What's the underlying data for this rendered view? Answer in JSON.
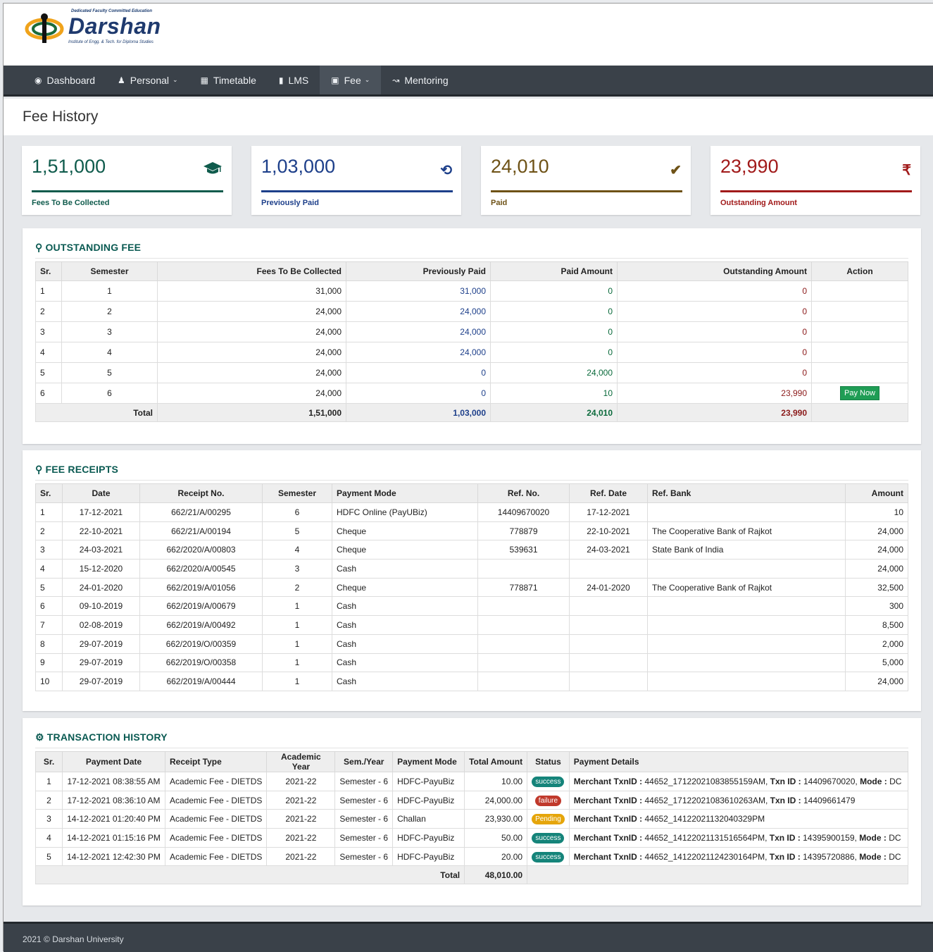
{
  "brand": {
    "tagline": "Dedicated Faculty Committed Education",
    "name": "Darshan",
    "subtitle": "Institute of Engg. & Tech. for Diploma Studies"
  },
  "nav": [
    {
      "label": "Dashboard",
      "icon": "dashboard-icon",
      "dropdown": false
    },
    {
      "label": "Personal",
      "icon": "user-icon",
      "dropdown": true
    },
    {
      "label": "Timetable",
      "icon": "calendar-icon",
      "dropdown": false
    },
    {
      "label": "LMS",
      "icon": "book-icon",
      "dropdown": false
    },
    {
      "label": "Fee",
      "icon": "money-icon",
      "dropdown": true,
      "active": true
    },
    {
      "label": "Mentoring",
      "icon": "chart-line-icon",
      "dropdown": false
    }
  ],
  "page_title": "Fee History",
  "stats": [
    {
      "value": "1,51,000",
      "label": "Fees To Be Collected",
      "icon": "graduation-cap-icon",
      "color": "#0f5b4c"
    },
    {
      "value": "1,03,000",
      "label": "Previously Paid",
      "icon": "history-icon",
      "color": "#1d3f8a"
    },
    {
      "value": "24,010",
      "label": "Paid",
      "icon": "check-icon",
      "color": "#6e5216"
    },
    {
      "value": "23,990",
      "label": "Outstanding Amount",
      "icon": "rupee-icon",
      "color": "#a11a1a"
    }
  ],
  "outstanding": {
    "title": "OUTSTANDING FEE",
    "headers": [
      "Sr.",
      "Semester",
      "Fees To Be Collected",
      "Previously Paid",
      "Paid Amount",
      "Outstanding Amount",
      "Action"
    ],
    "rows": [
      {
        "sr": "1",
        "sem": "1",
        "fees": "31,000",
        "prev": "31,000",
        "paid": "0",
        "out": "0",
        "action": ""
      },
      {
        "sr": "2",
        "sem": "2",
        "fees": "24,000",
        "prev": "24,000",
        "paid": "0",
        "out": "0",
        "action": ""
      },
      {
        "sr": "3",
        "sem": "3",
        "fees": "24,000",
        "prev": "24,000",
        "paid": "0",
        "out": "0",
        "action": ""
      },
      {
        "sr": "4",
        "sem": "4",
        "fees": "24,000",
        "prev": "24,000",
        "paid": "0",
        "out": "0",
        "action": ""
      },
      {
        "sr": "5",
        "sem": "5",
        "fees": "24,000",
        "prev": "0",
        "paid": "24,000",
        "out": "0",
        "action": ""
      },
      {
        "sr": "6",
        "sem": "6",
        "fees": "24,000",
        "prev": "0",
        "paid": "10",
        "out": "23,990",
        "action": "Pay Now"
      }
    ],
    "total": {
      "label": "Total",
      "fees": "1,51,000",
      "prev": "1,03,000",
      "paid": "24,010",
      "out": "23,990"
    }
  },
  "receipts": {
    "title": "FEE RECEIPTS",
    "headers": [
      "Sr.",
      "Date",
      "Receipt No.",
      "Semester",
      "Payment Mode",
      "Ref. No.",
      "Ref. Date",
      "Ref. Bank",
      "Amount"
    ],
    "rows": [
      [
        "1",
        "17-12-2021",
        "662/21/A/00295",
        "6",
        "HDFC Online (PayUBiz)",
        "14409670020",
        "17-12-2021",
        "",
        "10"
      ],
      [
        "2",
        "22-10-2021",
        "662/21/A/00194",
        "5",
        "Cheque",
        "778879",
        "22-10-2021",
        "The Cooperative Bank of Rajkot",
        "24,000"
      ],
      [
        "3",
        "24-03-2021",
        "662/2020/A/00803",
        "4",
        "Cheque",
        "539631",
        "24-03-2021",
        "State Bank of India",
        "24,000"
      ],
      [
        "4",
        "15-12-2020",
        "662/2020/A/00545",
        "3",
        "Cash",
        "",
        "",
        "",
        "24,000"
      ],
      [
        "5",
        "24-01-2020",
        "662/2019/A/01056",
        "2",
        "Cheque",
        "778871",
        "24-01-2020",
        "The Cooperative Bank of Rajkot",
        "32,500"
      ],
      [
        "6",
        "09-10-2019",
        "662/2019/A/00679",
        "1",
        "Cash",
        "",
        "",
        "",
        "300"
      ],
      [
        "7",
        "02-08-2019",
        "662/2019/A/00492",
        "1",
        "Cash",
        "",
        "",
        "",
        "8,500"
      ],
      [
        "8",
        "29-07-2019",
        "662/2019/O/00359",
        "1",
        "Cash",
        "",
        "",
        "",
        "2,000"
      ],
      [
        "9",
        "29-07-2019",
        "662/2019/O/00358",
        "1",
        "Cash",
        "",
        "",
        "",
        "5,000"
      ],
      [
        "10",
        "29-07-2019",
        "662/2019/A/00444",
        "1",
        "Cash",
        "",
        "",
        "",
        "24,000"
      ]
    ]
  },
  "transactions": {
    "title": "TRANSACTION HISTORY",
    "headers": [
      "Sr.",
      "Payment Date",
      "Receipt Type",
      "Academic Year",
      "Sem./Year",
      "Payment Mode",
      "Total Amount",
      "Status",
      "Payment Details"
    ],
    "rows": [
      {
        "sr": "1",
        "date": "17-12-2021 08:38:55 AM",
        "type": "Academic Fee - DIETDS",
        "ay": "2021-22",
        "sem": "Semester - 6",
        "mode": "HDFC-PayuBiz",
        "amount": "10.00",
        "status": "success",
        "merchant": "44652_17122021083855159AM",
        "txn": "14409670020",
        "pmode": "DC"
      },
      {
        "sr": "2",
        "date": "17-12-2021 08:36:10 AM",
        "type": "Academic Fee - DIETDS",
        "ay": "2021-22",
        "sem": "Semester - 6",
        "mode": "HDFC-PayuBiz",
        "amount": "24,000.00",
        "status": "failure",
        "merchant": "44652_17122021083610263AM",
        "txn": "14409661479",
        "pmode": ""
      },
      {
        "sr": "3",
        "date": "14-12-2021 01:20:40 PM",
        "type": "Academic Fee - DIETDS",
        "ay": "2021-22",
        "sem": "Semester - 6",
        "mode": "Challan",
        "amount": "23,930.00",
        "status": "Pending",
        "merchant": "44652_14122021132040329PM",
        "txn": "",
        "pmode": ""
      },
      {
        "sr": "4",
        "date": "14-12-2021 01:15:16 PM",
        "type": "Academic Fee - DIETDS",
        "ay": "2021-22",
        "sem": "Semester - 6",
        "mode": "HDFC-PayuBiz",
        "amount": "50.00",
        "status": "success",
        "merchant": "44652_14122021131516564PM",
        "txn": "14395900159",
        "pmode": "DC"
      },
      {
        "sr": "5",
        "date": "14-12-2021 12:42:30 PM",
        "type": "Academic Fee - DIETDS",
        "ay": "2021-22",
        "sem": "Semester - 6",
        "mode": "HDFC-PayuBiz",
        "amount": "20.00",
        "status": "success",
        "merchant": "44652_14122021124230164PM",
        "txn": "14395720886",
        "pmode": "DC"
      }
    ],
    "labels": {
      "merchant": "Merchant TxnID :",
      "txn": "Txn ID :",
      "mode": "Mode :"
    },
    "total": {
      "label": "Total",
      "amount": "48,010.00"
    }
  },
  "footer": "2021 © Darshan University"
}
